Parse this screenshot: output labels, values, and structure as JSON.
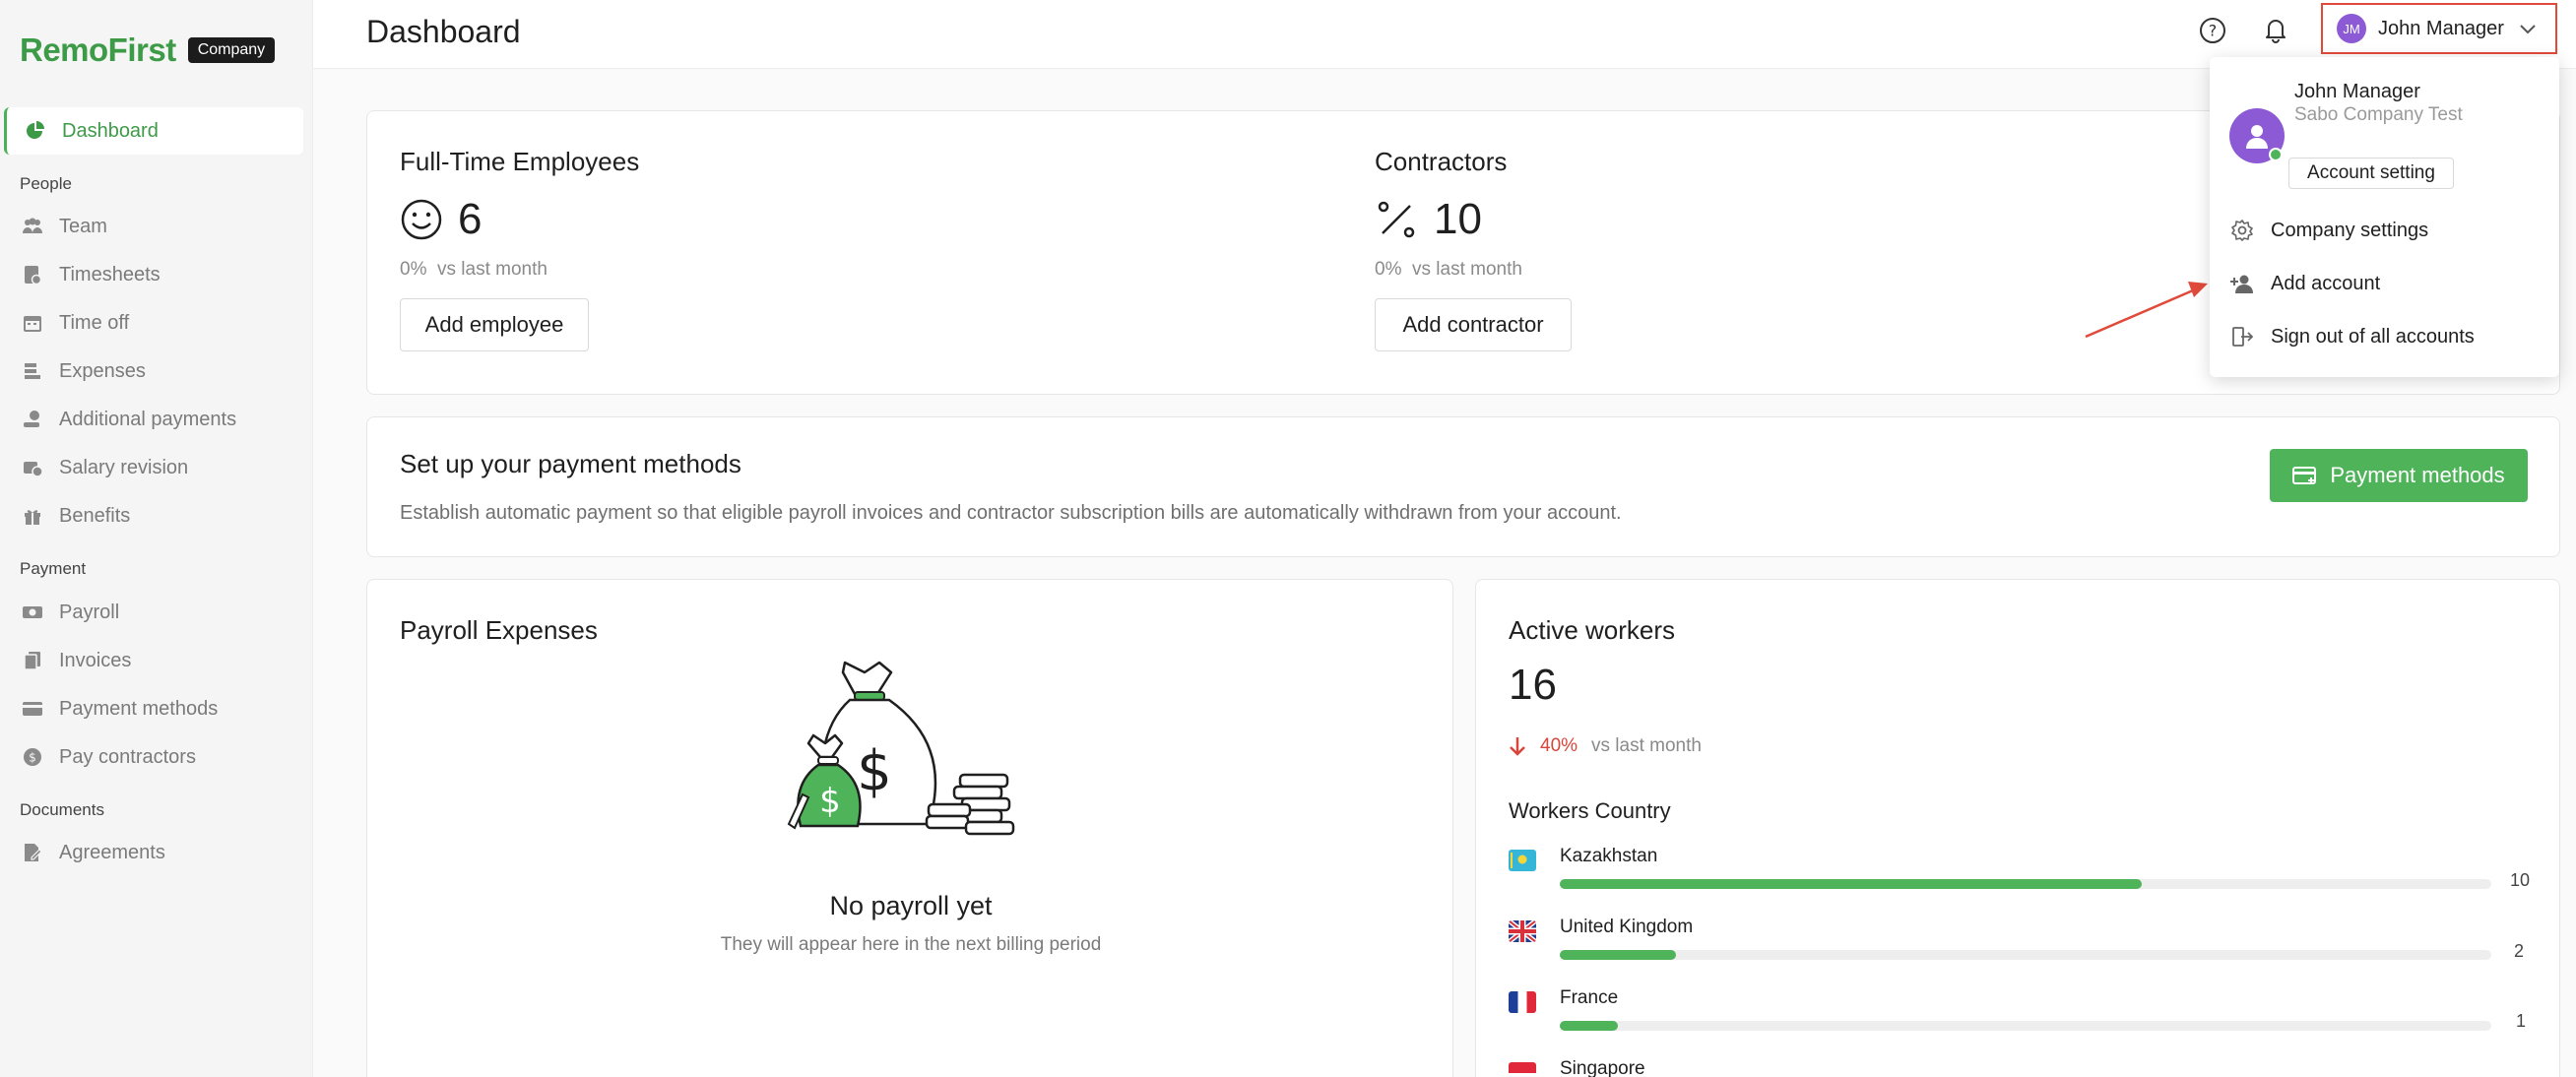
{
  "brand": {
    "logo": "RemoFirst",
    "badge": "Company"
  },
  "sidebar": {
    "dashboard": "Dashboard",
    "sections": {
      "people": "People",
      "payment": "Payment",
      "documents": "Documents"
    },
    "people_items": [
      "Team",
      "Timesheets",
      "Time off",
      "Expenses",
      "Additional payments",
      "Salary revision",
      "Benefits"
    ],
    "payment_items": [
      "Payroll",
      "Invoices",
      "Payment methods",
      "Pay contractors"
    ],
    "documents_items": [
      "Agreements"
    ]
  },
  "header": {
    "title": "Dashboard",
    "user": {
      "initials": "JM",
      "name": "John Manager"
    }
  },
  "dropdown": {
    "name": "John Manager",
    "company": "Sabo Company Test",
    "account_setting": "Account setting",
    "items": [
      "Company settings",
      "Add account",
      "Sign out of all accounts"
    ]
  },
  "stats": {
    "employees": {
      "title": "Full-Time Employees",
      "count": "6",
      "change": "0%",
      "vs": "vs last month",
      "button": "Add employee"
    },
    "contractors": {
      "title": "Contractors",
      "count": "10",
      "change": "0%",
      "vs": "vs last month",
      "button": "Add contractor"
    }
  },
  "payment_setup": {
    "title": "Set up your payment methods",
    "description": "Establish automatic payment so that eligible payroll invoices and contractor subscription bills are automatically withdrawn from your account.",
    "button": "Payment methods"
  },
  "payroll": {
    "title": "Payroll Expenses",
    "empty_title": "No payroll yet",
    "empty_sub": "They will appear here in the next billing period"
  },
  "active_workers": {
    "title": "Active workers",
    "count": "16",
    "change": "40%",
    "vs": "vs last month",
    "countries_title": "Workers Country",
    "countries": [
      {
        "name": "Kazakhstan",
        "count": "10",
        "share": 0.625
      },
      {
        "name": "United Kingdom",
        "count": "2",
        "share": 0.125
      },
      {
        "name": "France",
        "count": "1",
        "share": 0.0625
      },
      {
        "name": "Singapore",
        "count": "",
        "share": 0
      }
    ]
  },
  "colors": {
    "brand_green": "#3d9b48",
    "accent_green": "#4fb35a",
    "danger": "#e04a3a",
    "avatar_purple": "#8d5ad6"
  }
}
